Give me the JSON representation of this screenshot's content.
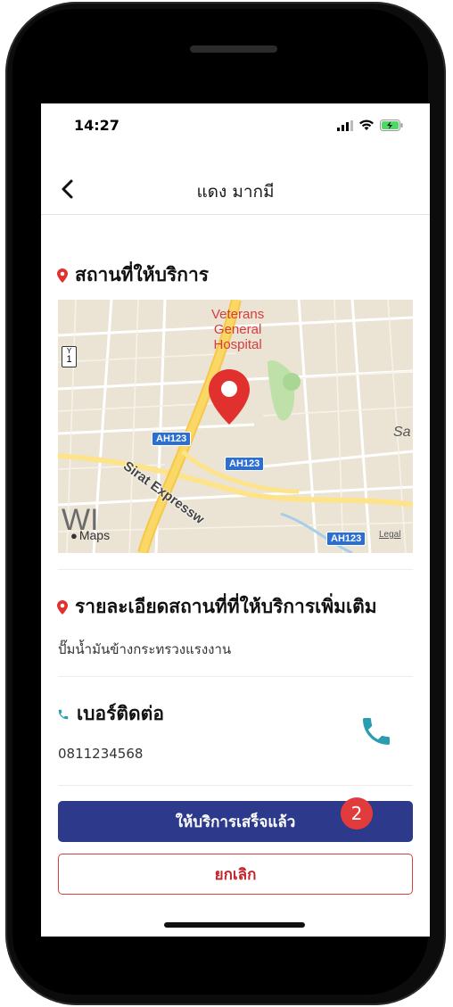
{
  "status_bar": {
    "time": "14:27"
  },
  "nav": {
    "title": "แดง มากมี"
  },
  "service_location": {
    "title": "สถานที่ให้บริการ",
    "map": {
      "poi_line1": "Veterans",
      "poi_line2": "General",
      "poi_line3": "Hospital",
      "road_name_1": "Sirat Expressw",
      "place_partial": "Sa",
      "place_partial_2": "WI",
      "route_shield": "AH123",
      "highway_shield": "1",
      "attribution": "Maps",
      "legal": "Legal"
    }
  },
  "details": {
    "title": "รายละเอียดสถานที่ที่ให้บริการเพิ่มเติม",
    "text": "ปั๊มน้ำมันข้างกระทรวงแรงงาน"
  },
  "contact": {
    "title": "เบอร์ติดต่อ",
    "phone": "0811234568"
  },
  "actions": {
    "done_label": "ให้บริการเสร็จแล้ว",
    "badge": "2",
    "cancel_label": "ยกเลิก"
  },
  "colors": {
    "primary": "#2d3a8c",
    "danger": "#d94040",
    "pin": "#e0312f",
    "call_icon": "#2a9db0"
  }
}
